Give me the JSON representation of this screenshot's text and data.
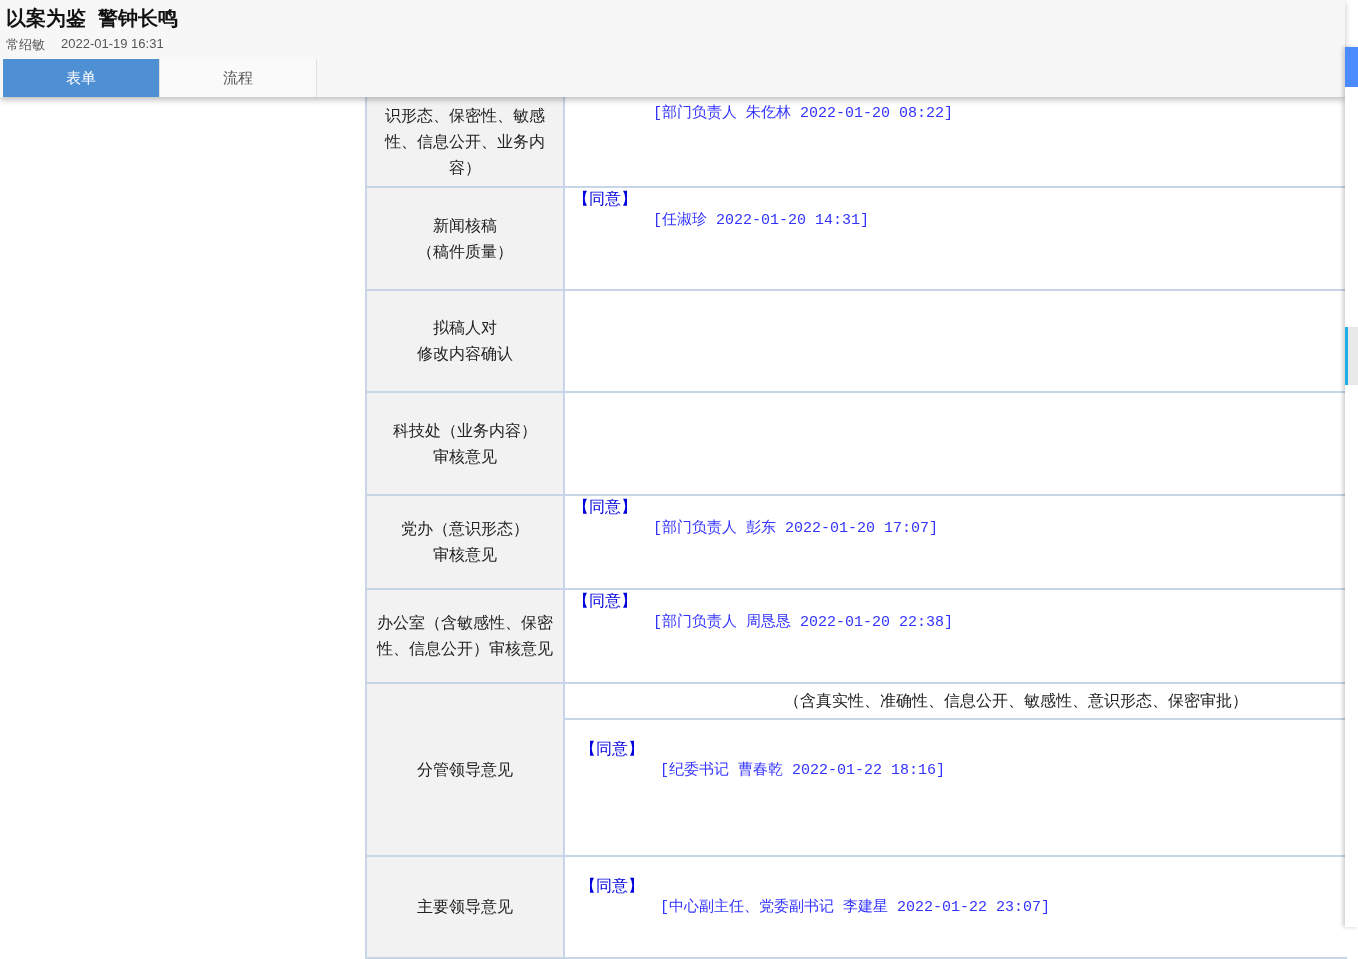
{
  "header": {
    "title": "以案为鉴",
    "subtitle": "警钟长鸣",
    "author": "常绍敏",
    "time": "2022-01-19 16:31"
  },
  "tabs": [
    {
      "label": "表单",
      "selected": true
    },
    {
      "label": "流程",
      "selected": false
    }
  ],
  "rows": [
    {
      "label": [
        "识形态、保密性、敏感",
        "性、信息公开、业务内",
        "容）"
      ],
      "signature": "[部门负责人 朱仡林 2022-01-20 08:22]"
    },
    {
      "label": [
        "新闻核稿",
        "（稿件质量）"
      ],
      "opinion": "【同意】",
      "signature": "[任淑珍 2022-01-20 14:31]"
    },
    {
      "label": [
        "拟稿人对",
        "修改内容确认"
      ]
    },
    {
      "label": [
        "科技处（业务内容）",
        "审核意见"
      ]
    },
    {
      "label": [
        "党办（意识形态）",
        "审核意见"
      ],
      "opinion": "【同意】",
      "signature": "[部门负责人 彭东 2022-01-20 17:07]"
    },
    {
      "label": [
        "办公室（含敏感性、保密",
        "性、信息公开）审核意见"
      ],
      "opinion": "【同意】",
      "signature": "[部门负责人 周恳恳 2022-01-20 22:38]"
    },
    {
      "label": [
        "分管领导意见"
      ],
      "note": "（含真实性、准确性、信息公开、敏感性、意识形态、保密审批）",
      "opinion": "【同意】",
      "signature": "[纪委书记 曹春乾 2022-01-22 18:16]"
    },
    {
      "label": [
        "主要领导意见"
      ],
      "opinion": "【同意】",
      "signature": "[中心副主任、党委副书记 李建星 2022-01-22 23:07]"
    }
  ]
}
